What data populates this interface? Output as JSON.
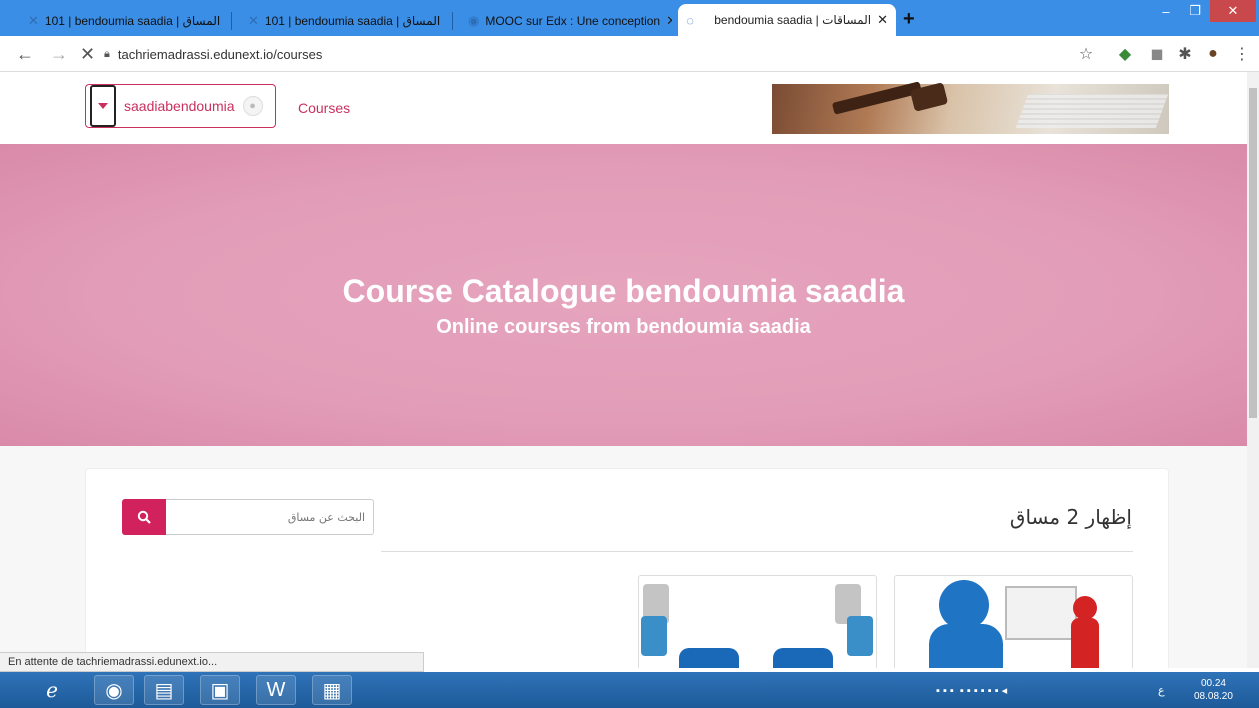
{
  "browser": {
    "tabs": [
      {
        "title": "101 | bendoumia saadia | المساق"
      },
      {
        "title": "101 | bendoumia saadia | المساق"
      },
      {
        "title": "MOOC sur Edx : Une conception"
      },
      {
        "title": "bendoumia saadia | المساقات"
      }
    ],
    "url": "tachriemadrassi.edunext.io/courses",
    "status_text": "En attente de tachriemadrassi.edunext.io..."
  },
  "header": {
    "username": "saadiabendoumia",
    "courses_link": "Courses"
  },
  "hero": {
    "title": "Course Catalogue bendoumia saadia",
    "subtitle": "Online courses from bendoumia saadia",
    "background_color": "#e29cb7"
  },
  "catalog": {
    "search_placeholder": "البحث عن مساق",
    "count_label": "إظهار 2 مساق",
    "accent_color": "#d1225e"
  },
  "taskbar": {
    "time": "00.24",
    "date": "08.08.20",
    "lang": "ع"
  }
}
